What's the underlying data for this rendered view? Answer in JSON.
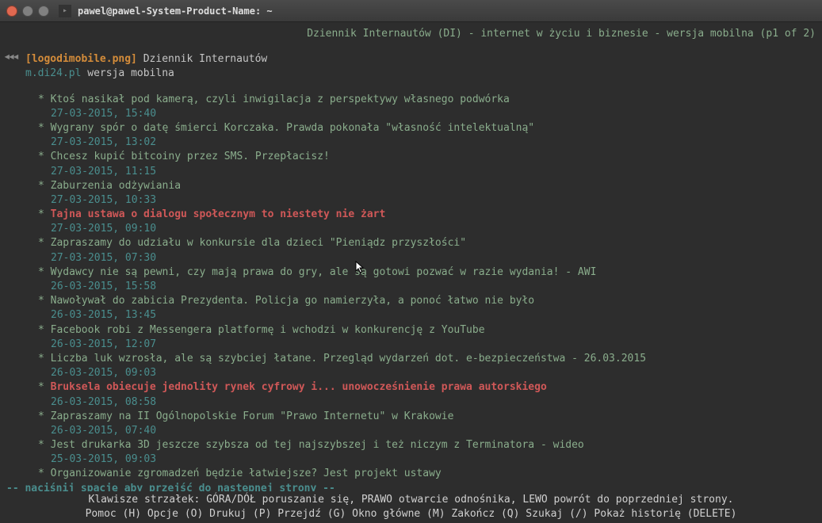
{
  "window": {
    "title": "pawel@pawel-System-Product-Name: ~"
  },
  "header": {
    "page_info": "Dziennik Internautów (DI) - internet w życiu i biznesie - wersja mobilna (p1 of 2)"
  },
  "logo": {
    "image_label": "[logodimobile.png]",
    "site_name": "Dziennik Internautów",
    "url": "m.di24.pl",
    "version": "wersja mobilna"
  },
  "articles": [
    {
      "title": "Ktoś nasikał pod kamerą, czyli inwigilacja z perspektywy własnego podwórka",
      "date": "27-03-2015, 15:40",
      "highlight": false
    },
    {
      "title": "Wygrany spór o datę śmierci Korczaka. Prawda pokonała \"własność intelektualną\"",
      "date": "27-03-2015, 13:02",
      "highlight": false
    },
    {
      "title": "Chcesz kupić bitcoiny przez SMS. Przepłacisz!",
      "date": "27-03-2015, 11:15",
      "highlight": false
    },
    {
      "title": "Zaburzenia odżywiania",
      "date": "27-03-2015, 10:33",
      "highlight": false
    },
    {
      "title": "Tajna ustawa o dialogu społecznym to niestety nie żart",
      "date": "27-03-2015, 09:10",
      "highlight": true
    },
    {
      "title": "Zapraszamy do udziału w konkursie dla dzieci \"Pieniądz przyszłości\"",
      "date": "27-03-2015, 07:30",
      "highlight": false
    },
    {
      "title": "Wydawcy nie są pewni, czy mają prawa do gry, ale są gotowi pozwać w razie wydania! - AWI",
      "date": "26-03-2015, 15:58",
      "highlight": false
    },
    {
      "title": "Nawoływał do zabicia Prezydenta. Policja go namierzyła, a ponoć łatwo nie było",
      "date": "26-03-2015, 13:45",
      "highlight": false
    },
    {
      "title": "Facebook robi z Messengera platformę i wchodzi w konkurencję z YouTube",
      "date": "26-03-2015, 12:07",
      "highlight": false
    },
    {
      "title": "Liczba luk wzrosła, ale są szybciej łatane. Przegląd wydarzeń dot. e-bezpieczeństwa - 26.03.2015",
      "date": "26-03-2015, 09:03",
      "highlight": false
    },
    {
      "title": "Bruksela obiecuje jednolity rynek cyfrowy i... unowocześnienie prawa autorskiego",
      "date": "26-03-2015, 08:58",
      "highlight": true
    },
    {
      "title": "Zapraszamy na II Ogólnopolskie Forum \"Prawo Internetu\" w Krakowie",
      "date": "26-03-2015, 07:40",
      "highlight": false
    },
    {
      "title": "Jest drukarka 3D jeszcze szybsza od tej najszybszej i też niczym z Terminatora - wideo",
      "date": "25-03-2015, 09:03",
      "highlight": false
    },
    {
      "title": "Organizowanie zgromadzeń będzie łatwiejsze? Jest projekt ustawy",
      "date": "",
      "highlight": false
    }
  ],
  "prompt": {
    "space_next": "-- naciśnij spację aby przejść do następnej strony --"
  },
  "footer": {
    "line1": "Klawisze strzałek: GÓRA/DÓŁ poruszanie się, PRAWO otwarcie odnośnika, LEWO powrót do poprzedniej strony.",
    "line2": " Pomoc (H)  Opcje (O)  Drukuj (P)  Przejdź (G)  Okno główne (M)  Zakończ (Q)  Szukaj (/)  Pokaż historię (DELETE)"
  }
}
